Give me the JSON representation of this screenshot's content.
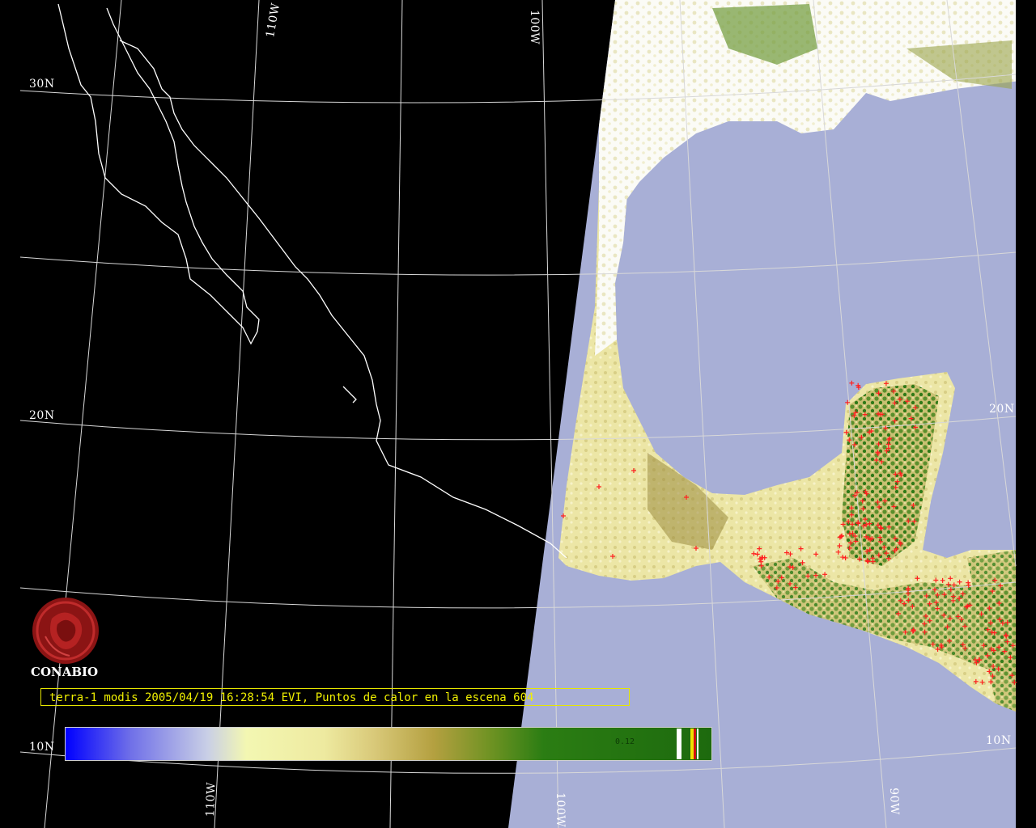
{
  "logo": {
    "name": "CONABIO"
  },
  "caption": "terra-1 modis 2005/04/19 16:28:54 EVI, Puntos de calor en la escena 604",
  "colorbar": {
    "value_label": "0.12"
  },
  "grid_labels": {
    "lat_30n": "30N",
    "lat_20n_left": "20N",
    "lat_20n_right": "20N",
    "lat_10n_left": "10N",
    "lat_10n_right": "10N",
    "lon_110w_top": "110W",
    "lon_100w_top": "100W",
    "lon_110w_bottom": "110W",
    "lon_100w_bottom": "100W",
    "lon_90w_bottom": "90W"
  },
  "colors": {
    "background": "#000000",
    "ocean": "#a6aed4",
    "land_dry": "#e8e2a0",
    "land_veg": "#4a8a24",
    "cloud": "#ffffff",
    "hotspot": "#ff2020",
    "caption_text": "#f0f000"
  }
}
